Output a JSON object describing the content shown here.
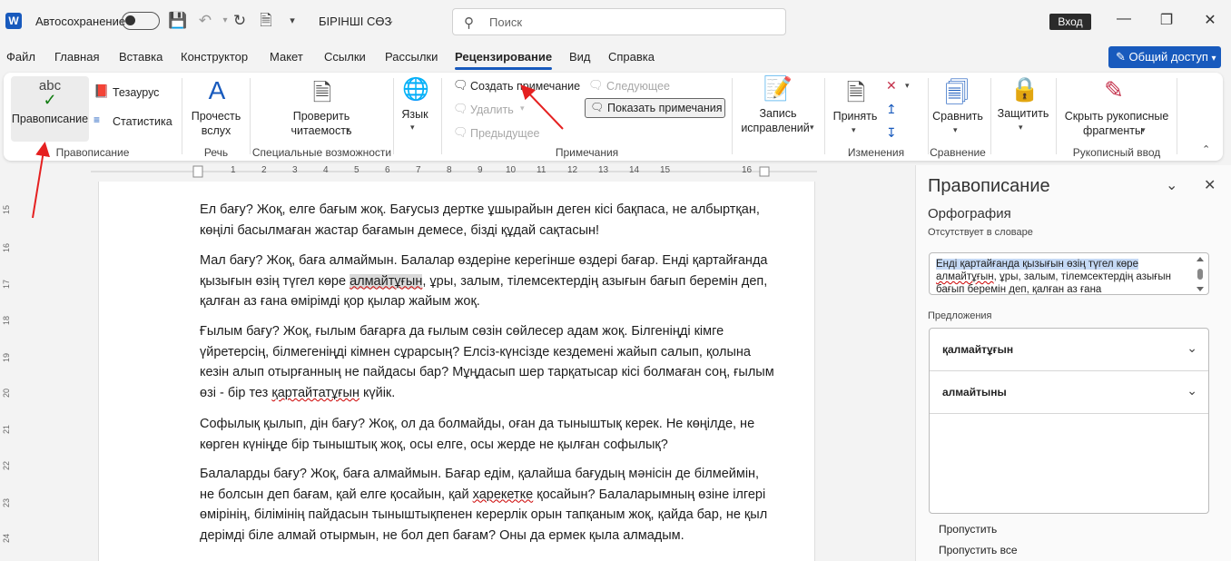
{
  "titlebar": {
    "autosave_label": "Автосохранение",
    "doc_title": "БІРІНШІ СӨЗ",
    "search_placeholder": "Поиск",
    "login": "Вход"
  },
  "menu": {
    "tabs": [
      "Файл",
      "Главная",
      "Вставка",
      "Конструктор",
      "Макет",
      "Ссылки",
      "Рассылки",
      "Рецензирование",
      "Вид",
      "Справка"
    ],
    "active_tab": "Рецензирование",
    "share": "Общий доступ"
  },
  "ribbon": {
    "spelling": {
      "abc": "abc",
      "label": "Правописание",
      "thesaurus": "Тезаурус",
      "stats": "Статистика",
      "group": "Правописание"
    },
    "speech": {
      "label1": "Прочесть",
      "label2": "вслух",
      "group": "Речь"
    },
    "accessibility": {
      "label1": "Проверить",
      "label2": "читаемость",
      "group": "Специальные возможности"
    },
    "language": {
      "label": "Язык"
    },
    "comments": {
      "new": "Создать примечание",
      "delete": "Удалить",
      "previous": "Предыдущее",
      "next": "Следующее",
      "show": "Показать примечания",
      "group": "Примечания"
    },
    "tracking": {
      "label1": "Запись",
      "label2": "исправлений"
    },
    "changes": {
      "accept": "Принять",
      "group": "Изменения"
    },
    "compare": {
      "label": "Сравнить",
      "group": "Сравнение"
    },
    "protect": {
      "label": "Защитить"
    },
    "ink": {
      "label1": "Скрыть рукописные",
      "label2": "фрагменты",
      "group": "Рукописный ввод"
    }
  },
  "ruler": {
    "numbers": [
      "1",
      "2",
      "3",
      "4",
      "5",
      "6",
      "7",
      "8",
      "9",
      "10",
      "11",
      "12",
      "13",
      "14",
      "15",
      "16"
    ],
    "vnumbers": [
      "15",
      "16",
      "17",
      "18",
      "19",
      "20",
      "21",
      "22",
      "23",
      "24"
    ]
  },
  "document": {
    "p1": "Ел бағу? Жоқ, елге бағым жоқ. Бағусыз дертке ұшырайын деген кісі бақпаса, не албыртқан, көңілі басылмаған жастар бағамын демесе, бізді құдай сақтасын!",
    "p2_a": "Мал бағу? Жоқ, баға алмаймын. Балалар өздеріне керегінше өздері бағар. Енді қартайғанда қызығын өзің түгел көре ",
    "p2_err": "алмайтұғын",
    "p2_b": ", ұры, залым, тілемсектердің азығын бағып беремін деп, қалған аз ғана өмірімді қор қылар жайым жоқ.",
    "p3_a": "Ғылым бағу? Жоқ, ғылым бағарға да ғылым сөзін сөйлесер адам жоқ. Білгеніңді кімге үйретерсің, білмегеніңді кімнен сұрарсың? Елсіз-күнсізде кездемені жайып салып, қолына кезін алып отырғанның не пайдасы бар? Мұңдасып шер тарқатысар кісі болмаған соң, ғылым өзі - бір тез ",
    "p3_err": "қартайтатұғын",
    "p3_b": " күйік.",
    "p4": "Софылық қылып, дін бағу? Жоқ, ол да болмайды, оған да тыныштық керек. Не көңілде, не көрген күніңде бір тыныштық жоқ, осы елге, осы жерде не қылған софылық?",
    "p5_a": "Балаларды бағу? Жоқ, баға алмаймын. Бағар едім, қалайша бағудың мәнісін де білмеймін, не болсын деп бағам, қай елге қосайын, қай ",
    "p5_err": "харекетке",
    "p5_b": " қосайын? Балаларымның өзіне ілгері өмірінің, білімінің пайдасын тыныштықпенен керерлік орын тапқаным жоқ, қайда бар, не қыл дерімді біле алмай отырмын, не бол деп бағам? Оны да ермек қыла алмадым."
  },
  "pane": {
    "title": "Правописание",
    "subtitle": "Орфография",
    "missing": "Отсутствует в словаре",
    "context_sel": "Енді қартайғанда қызығын өзің түгел көре",
    "context_err": "алмайтұғын",
    "context_rest": ", ұры, залым, тілемсектердің азығын бағып беремін деп, қалған аз ғана",
    "suggestions_label": "Предложения",
    "suggestions": [
      "қалмайтұғын",
      "алмайтыны"
    ],
    "ignore": "Пропустить",
    "ignore_all": "Пропустить все"
  }
}
